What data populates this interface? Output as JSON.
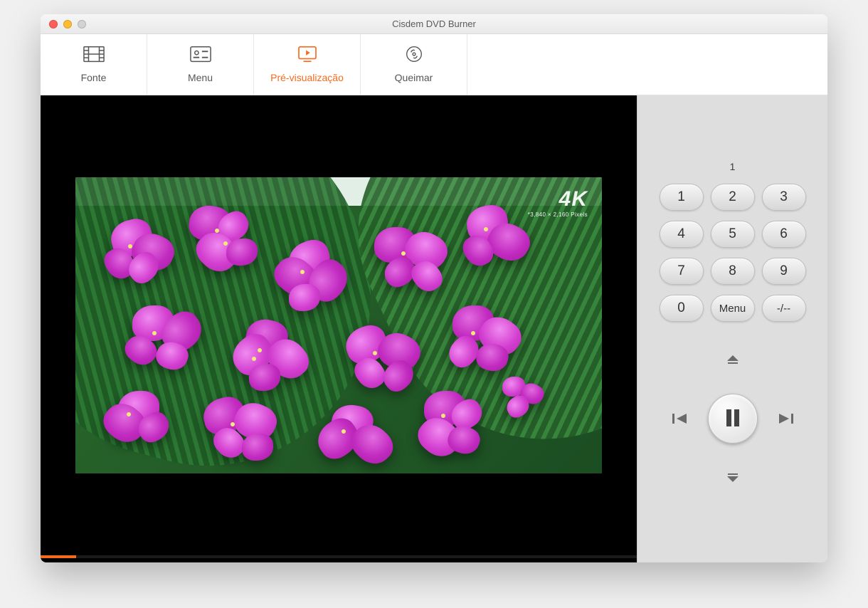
{
  "window": {
    "title": "Cisdem DVD Burner"
  },
  "tabs": {
    "source": "Fonte",
    "menu": "Menu",
    "preview": "Pré-visualização",
    "burn": "Queimar",
    "active": "preview"
  },
  "preview": {
    "badge": {
      "large": "4K",
      "small": "*3,840 × 2,160 Pixels"
    },
    "progress_percent": 6
  },
  "remote": {
    "chapter_display": "1",
    "keypad": [
      "1",
      "2",
      "3",
      "4",
      "5",
      "6",
      "7",
      "8",
      "9",
      "0"
    ],
    "menu_label": "Menu",
    "dash_label": "-/--"
  },
  "colors": {
    "accent": "#f56a1d"
  }
}
